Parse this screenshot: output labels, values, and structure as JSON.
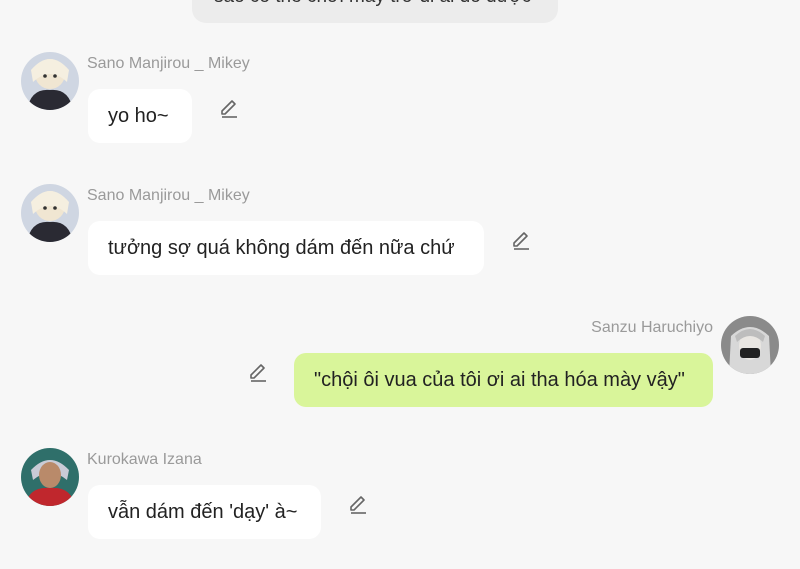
{
  "top_message": {
    "text": "sao có thể chơi mày trở đi ai đó được"
  },
  "messages": [
    {
      "sender": "Sano Manjirou _ Mikey",
      "text": "yo ho~",
      "edit_icon": "pencil-edit-icon"
    },
    {
      "sender": "Sano Manjirou _ Mikey",
      "text": "tưởng sợ quá không dám đến nữa chứ",
      "edit_icon": "pencil-edit-icon"
    },
    {
      "sender": "Sanzu Haruchiyo",
      "text": "\"chội ôi vua của tôi ơi ai tha hóa mày vậy\"",
      "edit_icon": "pencil-edit-icon"
    },
    {
      "sender": "Kurokawa Izana",
      "text": "vẫn dám đến 'dạy' à~",
      "edit_icon": "pencil-edit-icon"
    }
  ],
  "colors": {
    "background": "#f7f7f7",
    "incoming_bubble": "#ffffff",
    "outgoing_bubble": "#d9f59a",
    "sender_name": "#9a9a9a"
  }
}
